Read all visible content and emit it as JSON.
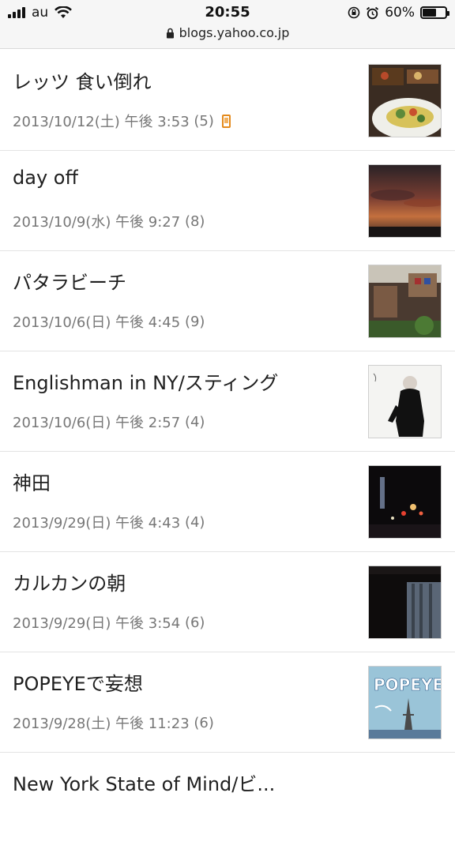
{
  "status_bar": {
    "carrier": "au",
    "time": "20:55",
    "battery": "60%",
    "battery_level": 0.6
  },
  "browser": {
    "url": "blogs.yahoo.co.jp"
  },
  "posts": [
    {
      "title": "レッツ 食い倒れ",
      "date": "2013/10/12(土) 午後 3:53",
      "comments": "(5)",
      "mobile_icon": true
    },
    {
      "title": "day off",
      "date": "2013/10/9(水) 午後 9:27",
      "comments": "(8)"
    },
    {
      "title": "パタラビーチ",
      "date": "2013/10/6(日) 午後 4:45",
      "comments": "(9)"
    },
    {
      "title": "Englishman in NY/スティング",
      "date": "2013/10/6(日) 午後 2:57",
      "comments": "(4)"
    },
    {
      "title": "神田",
      "date": "2013/9/29(日) 午後 4:43",
      "comments": "(4)"
    },
    {
      "title": "カルカンの朝",
      "date": "2013/9/29(日) 午後 3:54",
      "comments": "(6)"
    },
    {
      "title": "POPEYEで妄想",
      "date": "2013/9/28(土) 午後 11:23",
      "comments": "(6)"
    },
    {
      "title": "New York State of Mind/ビ..."
    }
  ],
  "thumbnail_text": {
    "popeye": "POPEYE"
  }
}
